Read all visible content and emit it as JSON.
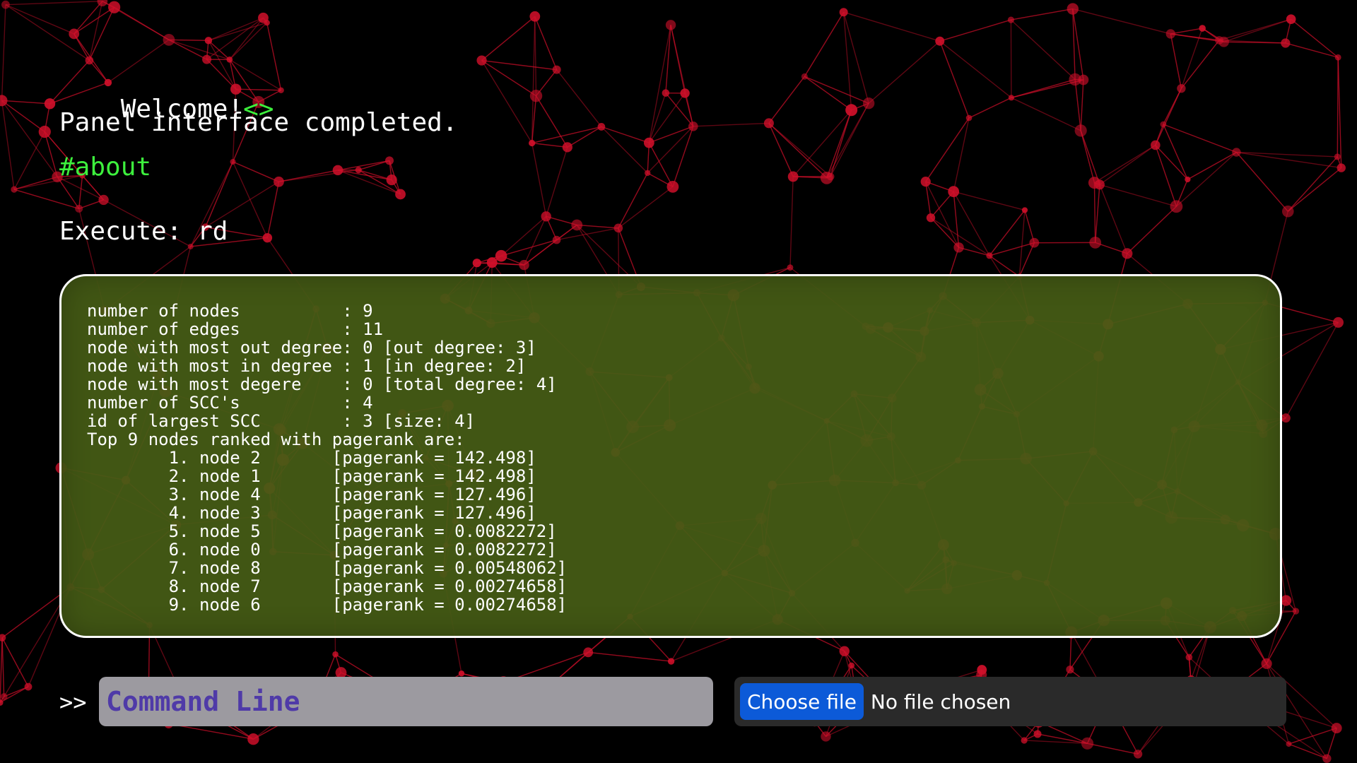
{
  "header": {
    "welcome_text": "Welcome!",
    "welcome_symbol": "<>",
    "status_message": "Panel interface completed.",
    "anchor_link": "#about",
    "execute_label": "Execute: rd"
  },
  "output": {
    "lines": [
      "number of nodes          : 9",
      "number of edges          : 11",
      "node with most out degree: 0 [out degree: 3]",
      "node with most in degree : 1 [in degree: 2]",
      "node with most degere    : 0 [total degree: 4]",
      "number of SCC's          : 4",
      "id of largest SCC        : 3 [size: 4]",
      "Top 9 nodes ranked with pagerank are:",
      "        1. node 2       [pagerank = 142.498]",
      "        2. node 1       [pagerank = 142.498]",
      "        3. node 4       [pagerank = 127.496]",
      "        4. node 3       [pagerank = 127.496]",
      "        5. node 5       [pagerank = 0.0082272]",
      "        6. node 0       [pagerank = 0.0082272]",
      "        7. node 8       [pagerank = 0.00548062]",
      "        8. node 7       [pagerank = 0.00274658]",
      "        9. node 6       [pagerank = 0.00274658]"
    ]
  },
  "command": {
    "prompt": ">>",
    "placeholder": "Command Line",
    "value": ""
  },
  "file_input": {
    "button_label": "Choose file",
    "status": "No file chosen"
  },
  "colors": {
    "background": "#000000",
    "network_nodes": "#d0102a",
    "accent_green": "#3df03d",
    "panel_fill": "#465c16",
    "command_text": "#4f3aa8",
    "file_button": "#0c5ad8"
  }
}
